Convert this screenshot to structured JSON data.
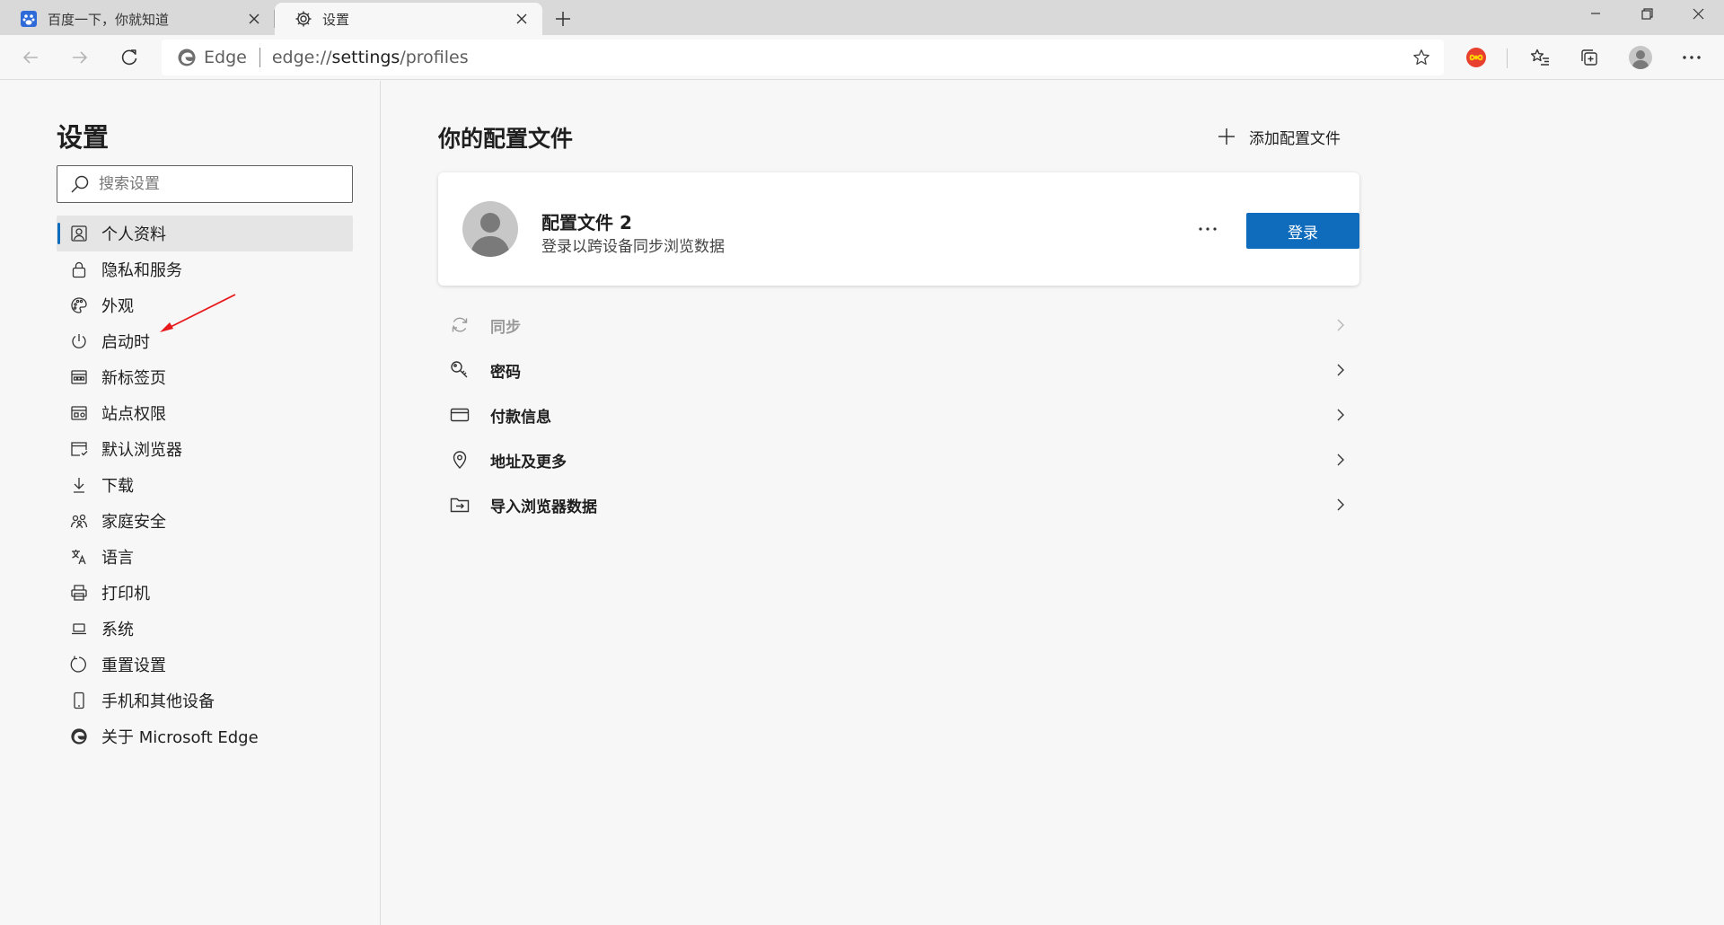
{
  "tabs": [
    {
      "title": "百度一下，你就知道",
      "favicon": "baidu-paw-icon"
    },
    {
      "title": "设置",
      "favicon": "gear-icon",
      "active": true
    }
  ],
  "omnibox": {
    "brand": "Edge",
    "url_scheme": "edge://",
    "url_host": "settings",
    "url_path": "/profiles"
  },
  "sidebar": {
    "title": "设置",
    "search_placeholder": "搜索设置",
    "items": [
      {
        "label": "个人资料",
        "icon": "profile-icon",
        "active": true
      },
      {
        "label": "隐私和服务",
        "icon": "lock-icon"
      },
      {
        "label": "外观",
        "icon": "palette-icon"
      },
      {
        "label": "启动时",
        "icon": "power-icon"
      },
      {
        "label": "新标签页",
        "icon": "new-tab-icon"
      },
      {
        "label": "站点权限",
        "icon": "site-permissions-icon"
      },
      {
        "label": "默认浏览器",
        "icon": "default-browser-icon"
      },
      {
        "label": "下载",
        "icon": "download-icon"
      },
      {
        "label": "家庭安全",
        "icon": "family-icon"
      },
      {
        "label": "语言",
        "icon": "language-icon"
      },
      {
        "label": "打印机",
        "icon": "printer-icon"
      },
      {
        "label": "系统",
        "icon": "laptop-icon"
      },
      {
        "label": "重置设置",
        "icon": "reset-icon"
      },
      {
        "label": "手机和其他设备",
        "icon": "phone-icon"
      },
      {
        "label": "关于 Microsoft Edge",
        "icon": "edge-logo-icon"
      }
    ]
  },
  "main": {
    "title": "你的配置文件",
    "add_profile": "添加配置文件",
    "profile": {
      "name": "配置文件 2",
      "subtitle": "登录以跨设备同步浏览数据",
      "signin_label": "登录",
      "more_label": "···"
    },
    "rows": [
      {
        "label": "同步",
        "icon": "sync-icon",
        "disabled": true
      },
      {
        "label": "密码",
        "icon": "key-icon"
      },
      {
        "label": "付款信息",
        "icon": "card-icon"
      },
      {
        "label": "地址及更多",
        "icon": "location-pin-icon"
      },
      {
        "label": "导入浏览器数据",
        "icon": "import-icon"
      }
    ]
  },
  "colors": {
    "accent": "#0f6cbd",
    "tabstrip": "#d9d9d9",
    "background": "#f7f7f7",
    "annotation_arrow": "#e8191b"
  }
}
